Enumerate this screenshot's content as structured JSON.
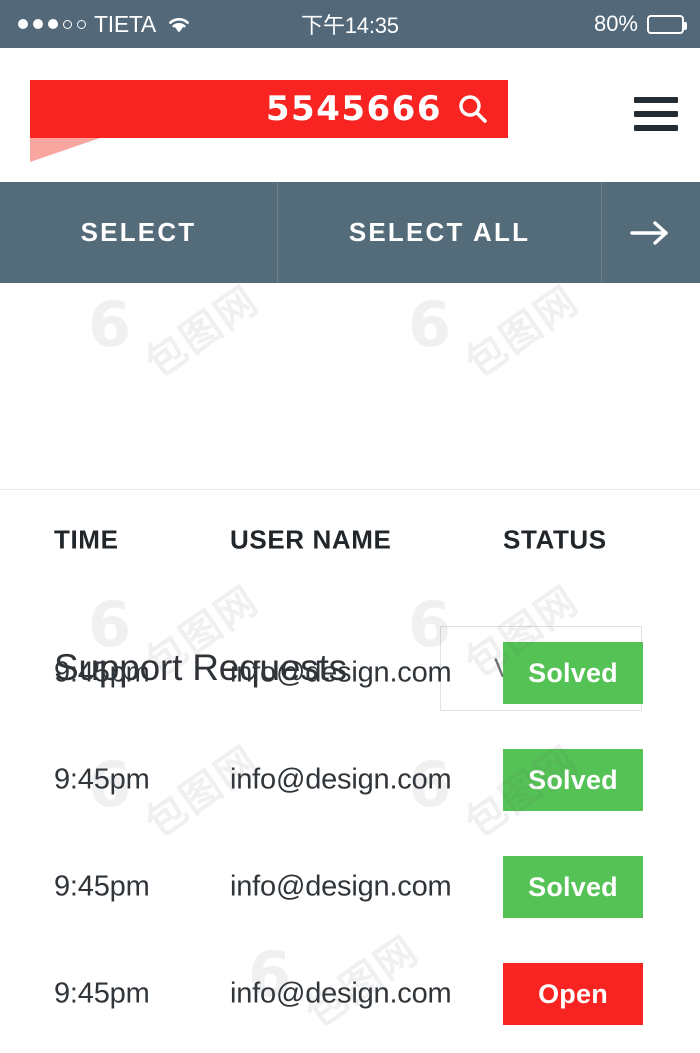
{
  "status_bar": {
    "signal_dots_filled": 3,
    "signal_dots_empty": 2,
    "carrier": "TIETA",
    "wifi_icon": "wifi-icon",
    "time": "下午14:35",
    "battery_percent": "80%",
    "battery_icon": "battery-icon",
    "background_color": "#53697a"
  },
  "search_banner": {
    "value": "5545666",
    "placeholder": "Search",
    "search_icon": "search-icon",
    "ribbon_color": "#f72421",
    "fold_color": "#f9a5a0",
    "menu_icon": "hamburger-menu-icon"
  },
  "nav": {
    "background_color": "#546b7a",
    "items": [
      {
        "label": "SELECT",
        "active": true
      },
      {
        "label": "SELECT ALL",
        "active": false
      },
      {
        "label": "→",
        "name": "arrow-right-icon",
        "active": false
      }
    ]
  },
  "section": {
    "title": "Support Requests",
    "view_all_label": "View All"
  },
  "table": {
    "columns": [
      "TIME",
      "USER NAME",
      "STATUS"
    ],
    "rows": [
      {
        "time": "9:45pm",
        "user": "info@design.com",
        "status": "Solved",
        "status_type": "solved"
      },
      {
        "time": "9:45pm",
        "user": "info@design.com",
        "status": "Solved",
        "status_type": "solved"
      },
      {
        "time": "9:45pm",
        "user": "info@design.com",
        "status": "Solved",
        "status_type": "solved"
      },
      {
        "time": "9:45pm",
        "user": "info@design.com",
        "status": "Open",
        "status_type": "open"
      }
    ],
    "status_colors": {
      "solved": "#55c255",
      "open": "#f72421"
    }
  },
  "watermark": {
    "mark": "6",
    "text": "包图网"
  }
}
